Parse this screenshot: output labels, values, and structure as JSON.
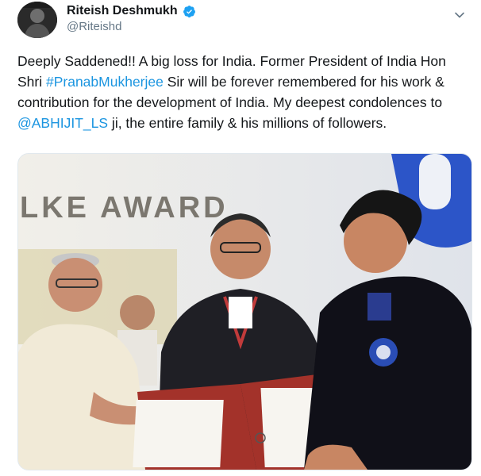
{
  "tweet": {
    "author": {
      "display_name": "Riteish Deshmukh",
      "handle": "@Riteishd",
      "verified": true,
      "avatar_icon": "profile-avatar"
    },
    "menu_icon": "chevron-down-icon",
    "text": {
      "part1": "Deeply Saddened!! A big loss for India. Former President of India Hon Shri ",
      "hashtag": "#PranabMukherjee",
      "part2": " Sir will be forever remembered for his work & contribution for the development of India. My deepest condolences to ",
      "mention": "@ABHIJIT_LS",
      "part3": " ji, the entire family & his millions of followers."
    },
    "media": {
      "type": "photo",
      "backdrop_text": "LKE AWARD"
    },
    "colors": {
      "link": "#1b95e0",
      "verified": "#1da1f2",
      "text": "#14171a",
      "secondary": "#657786"
    }
  }
}
